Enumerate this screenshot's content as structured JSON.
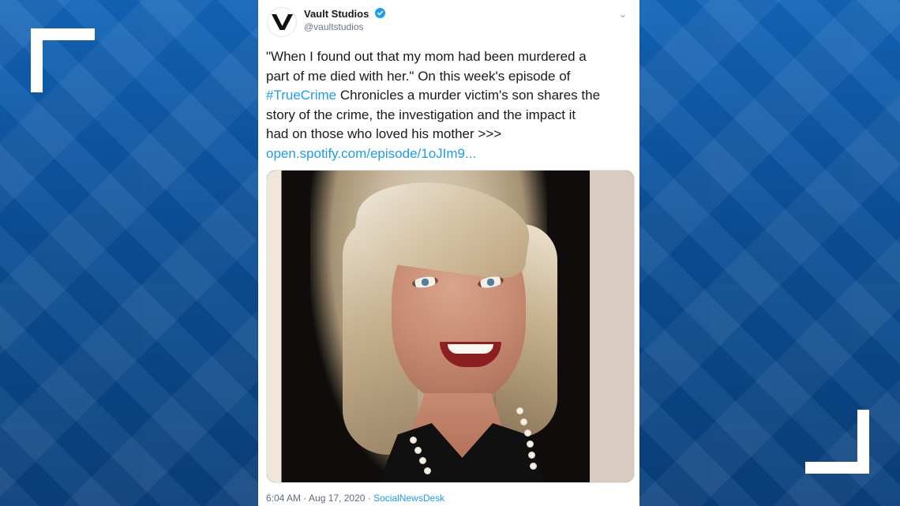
{
  "tweet": {
    "account": {
      "name": "Vault Studios",
      "handle": "@vaultstudios",
      "avatar_letter": "V",
      "verified_icon": "verified-check-icon"
    },
    "menu_icon": "chevron-down-icon",
    "text": {
      "line1": "\"When I found out that my mom had been murdered a",
      "line2": "part of me died with her.\" On this week's episode of",
      "hashtag": "#TrueCrime",
      "line3_rest": " Chronicles a murder victim's son shares the",
      "line4": "story of the crime, the investigation and the impact it",
      "line5": "had on those who loved his mother >>>",
      "link": "open.spotify.com/episode/1oJIm9..."
    },
    "meta": {
      "time": "6:04 AM",
      "separator1": " · ",
      "date": "Aug 17, 2020",
      "separator2": " · ",
      "source": "SocialNewsDesk"
    }
  },
  "colors": {
    "background_blue": "#0d4f99",
    "twitter_blue": "#1d9bf0",
    "card": "#ffffff"
  }
}
